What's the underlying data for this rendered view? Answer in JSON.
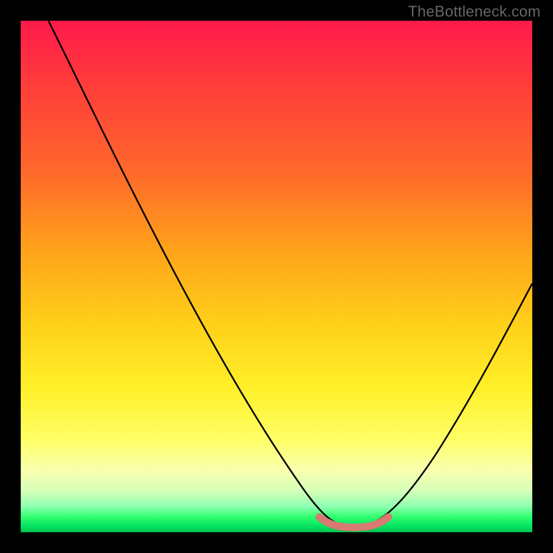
{
  "watermark": "TheBottleneck.com",
  "chart_data": {
    "type": "line",
    "title": "",
    "xlabel": "",
    "ylabel": "",
    "xlim": [
      0,
      100
    ],
    "ylim": [
      0,
      100
    ],
    "series": [
      {
        "name": "bottleneck-curve",
        "x": [
          0,
          5,
          10,
          15,
          20,
          25,
          30,
          35,
          40,
          45,
          50,
          55,
          58,
          60,
          62,
          64,
          66,
          68,
          70,
          72,
          75,
          80,
          85,
          90,
          95,
          100
        ],
        "y": [
          100,
          93,
          86,
          79,
          71,
          63,
          55,
          47,
          39,
          31,
          23,
          14,
          8,
          4,
          1,
          0,
          0,
          0,
          1,
          4,
          10,
          20,
          30,
          40,
          50,
          60
        ]
      },
      {
        "name": "highlight-basin",
        "x": [
          58,
          60,
          62,
          64,
          66,
          68,
          70,
          72
        ],
        "y": [
          2.2,
          1.3,
          0.8,
          0.6,
          0.6,
          0.8,
          1.3,
          2.2
        ]
      }
    ],
    "colors": {
      "curve": "#000000",
      "highlight": "#d77a72",
      "background_top": "#ff1a4b",
      "background_bottom": "#00c050"
    }
  }
}
